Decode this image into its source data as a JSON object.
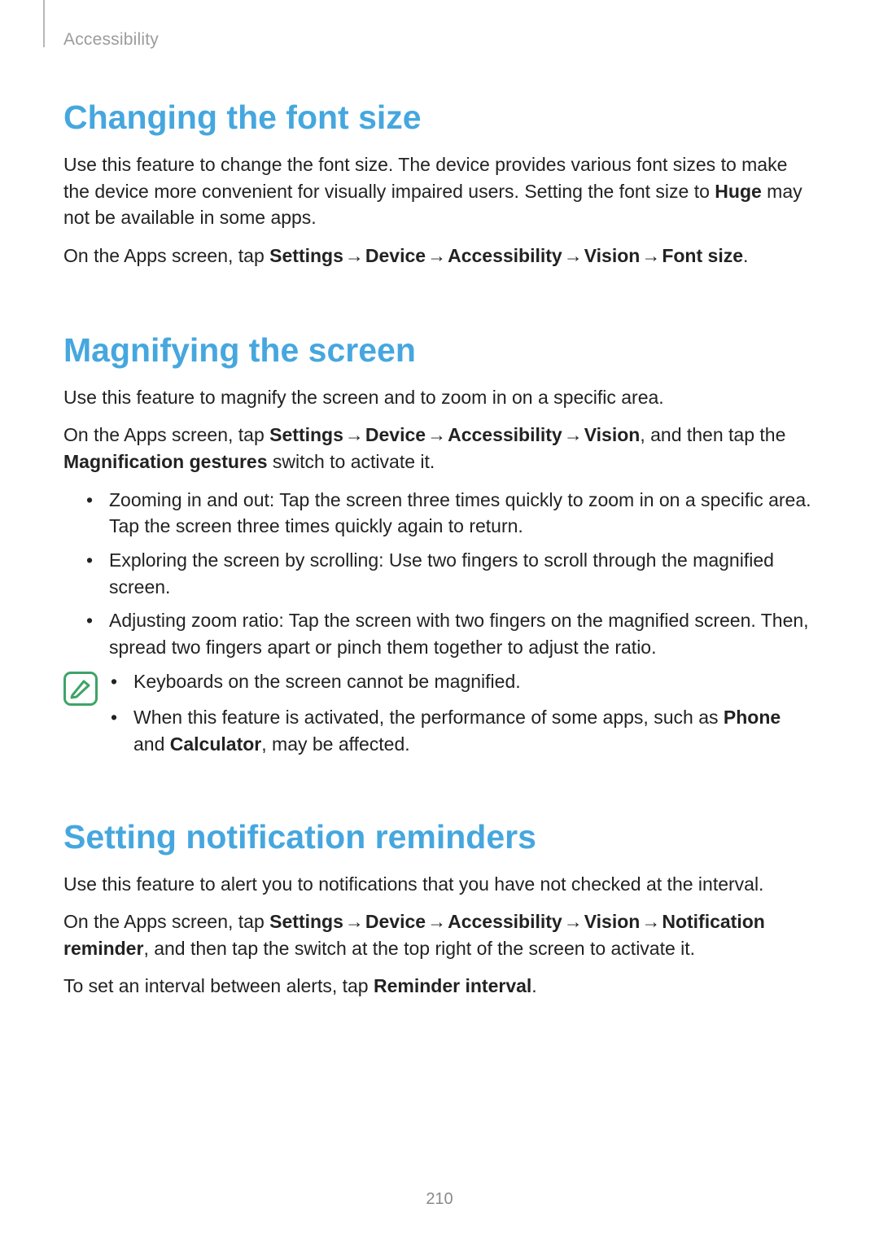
{
  "running_head": "Accessibility",
  "page_number": "210",
  "sections": {
    "font_size": {
      "title": "Changing the font size",
      "para1_pre": "Use this feature to change the font size. The device provides various font sizes to make the device more convenient for visually impaired users. Setting the font size to ",
      "para1_bold": "Huge",
      "para1_post": " may not be available in some apps.",
      "path_prefix": "On the Apps screen, tap ",
      "path_settings": "Settings",
      "path_device": "Device",
      "path_accessibility": "Accessibility",
      "path_vision": "Vision",
      "path_fontsize": "Font size",
      "path_suffix": "."
    },
    "magnify": {
      "title": "Magnifying the screen",
      "para1": "Use this feature to magnify the screen and to zoom in on a specific area.",
      "path_prefix": "On the Apps screen, tap ",
      "path_settings": "Settings",
      "path_device": "Device",
      "path_accessibility": "Accessibility",
      "path_vision": "Vision",
      "path_mid1": ", and then tap the ",
      "path_maggest": "Magnification gestures",
      "path_suffix": " switch to activate it.",
      "bullets": [
        "Zooming in and out: Tap the screen three times quickly to zoom in on a specific area. Tap the screen three times quickly again to return.",
        "Exploring the screen by scrolling: Use two fingers to scroll through the magnified screen.",
        "Adjusting zoom ratio: Tap the screen with two fingers on the magnified screen. Then, spread two fingers apart or pinch them together to adjust the ratio."
      ],
      "note": {
        "item1": "Keyboards on the screen cannot be magnified.",
        "item2_pre": "When this feature is activated, the performance of some apps, such as ",
        "item2_phone": "Phone",
        "item2_mid": " and ",
        "item2_calc": "Calculator",
        "item2_post": ", may be affected."
      }
    },
    "reminders": {
      "title": "Setting notification reminders",
      "para1": "Use this feature to alert you to notifications that you have not checked at the interval.",
      "path_prefix": "On the Apps screen, tap ",
      "path_settings": "Settings",
      "path_device": "Device",
      "path_accessibility": "Accessibility",
      "path_vision": "Vision",
      "path_notif": "Notification reminder",
      "path_suffix": ", and then tap the switch at the top right of the screen to activate it.",
      "para3_pre": "To set an interval between alerts, tap ",
      "para3_bold": "Reminder interval",
      "para3_post": "."
    }
  },
  "glyphs": {
    "arrow": "→"
  }
}
